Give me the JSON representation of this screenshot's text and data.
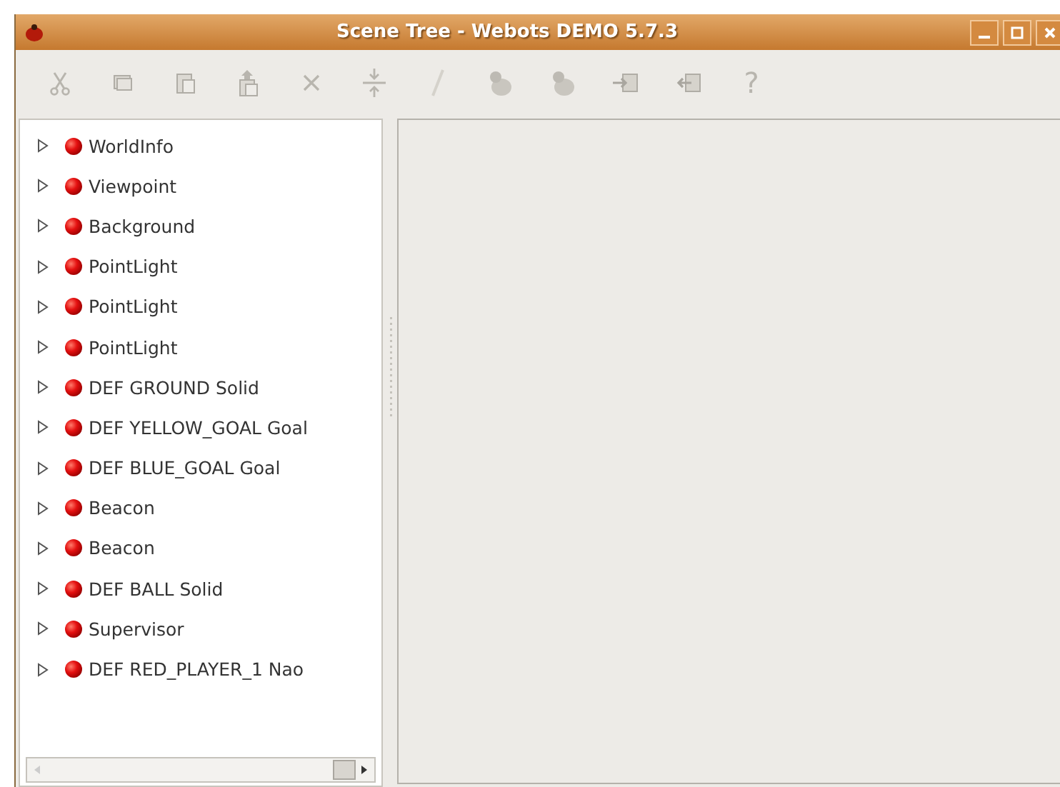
{
  "window": {
    "title": "Scene Tree - Webots DEMO 5.7.3"
  },
  "toolbar": {
    "help_label": "?"
  },
  "tree": {
    "items": [
      {
        "label": "WorldInfo",
        "expanded": false
      },
      {
        "label": "Viewpoint",
        "expanded": false
      },
      {
        "label": "Background",
        "expanded": false
      },
      {
        "label": "PointLight",
        "expanded": false
      },
      {
        "label": "PointLight",
        "expanded": false
      },
      {
        "label": "PointLight",
        "expanded": false
      },
      {
        "label": "DEF GROUND Solid",
        "expanded": false
      },
      {
        "label": "DEF YELLOW_GOAL Goal",
        "expanded": false
      },
      {
        "label": "DEF BLUE_GOAL Goal",
        "expanded": false
      },
      {
        "label": "Beacon",
        "expanded": false
      },
      {
        "label": "Beacon",
        "expanded": false
      },
      {
        "label": "DEF BALL Solid",
        "expanded": false
      },
      {
        "label": "Supervisor",
        "expanded": false
      },
      {
        "label": "DEF RED_PLAYER_1 Nao",
        "expanded": false
      }
    ]
  }
}
